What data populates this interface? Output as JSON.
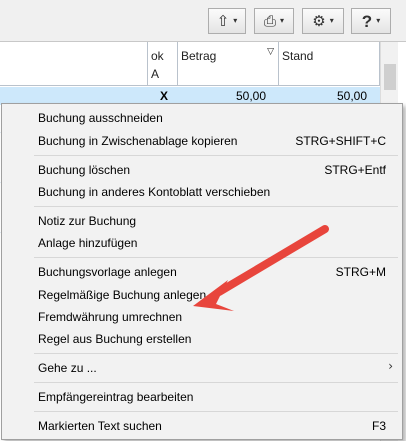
{
  "toolbar": {
    "buttons": [
      {
        "name": "export-button",
        "icon": "export-icon",
        "glyph": "⇧"
      },
      {
        "name": "print-button",
        "icon": "printer-icon",
        "glyph": "⎙"
      },
      {
        "name": "settings-button",
        "icon": "gear-icon",
        "glyph": "⚙"
      },
      {
        "name": "help-button",
        "icon": "help-icon",
        "glyph": "?"
      }
    ],
    "dropdown_glyph": "▾"
  },
  "table": {
    "columns": [
      {
        "key": "ok",
        "line1": "ok",
        "line2": "A"
      },
      {
        "key": "betrag",
        "line1": "Betrag",
        "sort": "▽"
      },
      {
        "key": "stand",
        "line1": "Stand"
      }
    ],
    "selected_row": {
      "ok": "X",
      "betrag": "50,00",
      "stand": "50,00"
    },
    "selection_color": "#cde8fb"
  },
  "context_menu": {
    "items": [
      {
        "label": "Buchung ausschneiden",
        "shortcut": ""
      },
      {
        "label": "Buchung in Zwischenablage kopieren",
        "shortcut": "STRG+SHIFT+C"
      },
      {
        "label": "Buchung löschen",
        "shortcut": "STRG+Entf"
      },
      {
        "label": "Buchung in anderes Kontoblatt verschieben",
        "shortcut": ""
      },
      {
        "label": "Notiz zur Buchung",
        "shortcut": ""
      },
      {
        "label": "Anlage hinzufügen",
        "shortcut": ""
      },
      {
        "label": "Buchungsvorlage anlegen",
        "shortcut": "STRG+M"
      },
      {
        "label": "Regelmäßige Buchung anlegen",
        "shortcut": ""
      },
      {
        "label": "Fremdwährung umrechnen",
        "shortcut": ""
      },
      {
        "label": "Regel aus Buchung erstellen",
        "shortcut": ""
      },
      {
        "label": "Gehe zu ...",
        "shortcut": "",
        "submenu_glyph": "›"
      },
      {
        "label": "Empfängereintrag bearbeiten",
        "shortcut": ""
      },
      {
        "label": "Markierten Text suchen",
        "shortcut": "F3"
      }
    ]
  },
  "annotation": {
    "type": "arrow",
    "color": "#e8453c",
    "points_to": "Fremdwährung umrechnen"
  }
}
